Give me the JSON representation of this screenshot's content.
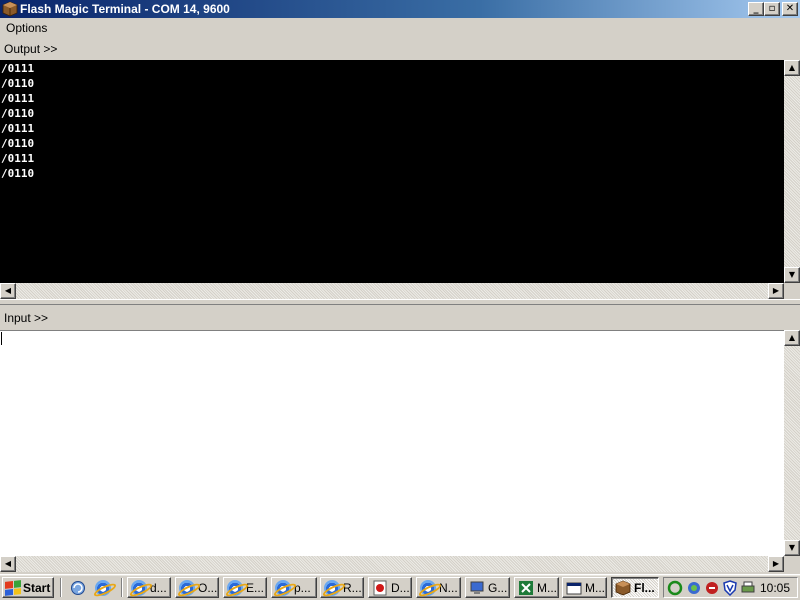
{
  "window": {
    "title": "Flash Magic Terminal - COM 14, 9600",
    "buttons": {
      "minimize": "_",
      "maximize": "▫",
      "close": "✕"
    }
  },
  "menu": {
    "options_label": "Options"
  },
  "output": {
    "label": "Output >>",
    "lines": [
      "/0111",
      "/0110",
      "/0111",
      "/0110",
      "/0111",
      "/0110",
      "/0111",
      "/0110"
    ]
  },
  "input": {
    "label": "Input >>",
    "value": ""
  },
  "scroll": {
    "up": "▲",
    "down": "▼",
    "left": "◀",
    "right": "▶"
  },
  "taskbar": {
    "start_label": "Start",
    "tasks": [
      {
        "label": "d...",
        "icon": "ie-icon"
      },
      {
        "label": "O...",
        "icon": "ie-icon"
      },
      {
        "label": "E...",
        "icon": "ie-icon"
      },
      {
        "label": "p...",
        "icon": "ie-icon"
      },
      {
        "label": "R...",
        "icon": "ie-icon"
      },
      {
        "label": "D...",
        "icon": "pdf-icon"
      },
      {
        "label": "N...",
        "icon": "ie-icon"
      },
      {
        "label": "G...",
        "icon": "computer-icon"
      },
      {
        "label": "M...",
        "icon": "excel-icon"
      },
      {
        "label": "M...",
        "icon": "window-icon"
      },
      {
        "label": "Fl...",
        "icon": "flash-magic-icon",
        "active": true
      }
    ],
    "clock": "10:05"
  }
}
